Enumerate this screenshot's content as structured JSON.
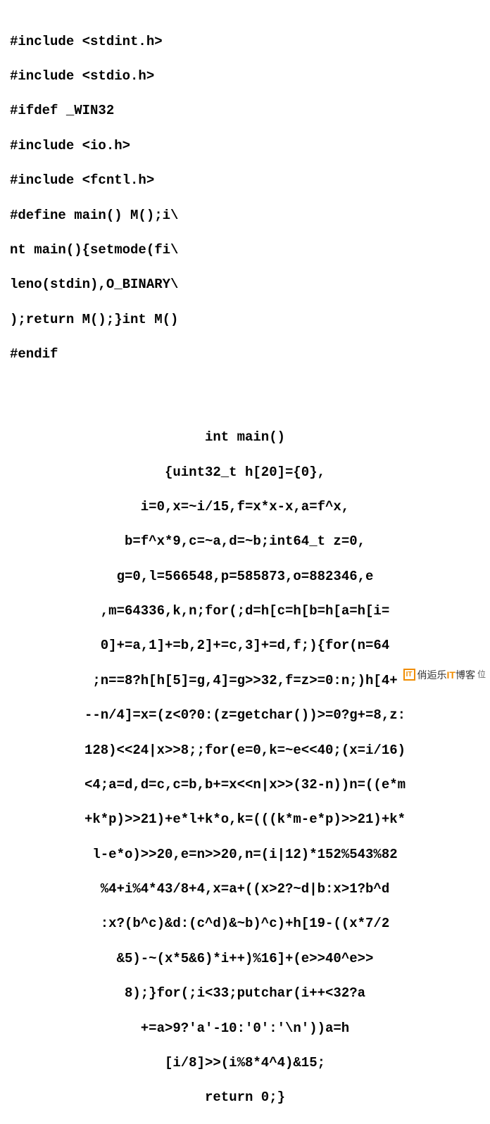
{
  "code_top": {
    "l0": "#include <stdint.h>",
    "l1": "#include <stdio.h>",
    "l2": "#ifdef _WIN32",
    "l3": "#include <io.h>",
    "l4": "#include <fcntl.h>",
    "l5": "#define main() M();i\\",
    "l6": "nt main(){setmode(fi\\",
    "l7": "leno(stdin),O_BINARY\\",
    "l8": ");return M();}int M()",
    "l9": "#endif"
  },
  "code_diamond": {
    "l0": "int main()",
    "l1": "{uint32_t h[20]={0},",
    "l2": "i=0,x=~i/15,f=x*x-x,a=f^x,",
    "l3": "b=f^x*9,c=~a,d=~b;int64_t z=0,",
    "l4": "g=0,l=566548,p=585873,o=882346,e",
    "l5": ",m=64336,k,n;for(;d=h[c=h[b=h[a=h[i=",
    "l6": "0]+=a,1]+=b,2]+=c,3]+=d,f;){for(n=64",
    "l7": ";n==8?h[h[5]=g,4]=g>>32,f=z>=0:n;)h[4+",
    "l8": "--n/4]=x=(z<0?0:(z=getchar())>=0?g+=8,z:",
    "l9": "128)<<24|x>>8;;for(e=0,k=~e<<40;(x=i/16)",
    "l10": "<4;a=d,d=c,c=b,b+=x<<n|x>>(32-n))n=((e*m",
    "l11": "+k*p)>>21)+e*l+k*o,k=(((k*m-e*p)>>21)+k*",
    "l12": "l-e*o)>>20,e=n>>20,n=(i|12)*152%543%82",
    "l13": "%4+i%4*43/8+4,x=a+((x>2?~d|b:x>1?b^d",
    "l14": ":x?(b^c)&d:(c^d)&~b)^c)+h[19-((x*7/2",
    "l15": "&5)-~(x*5&6)*i++)%16]+(e>>40^e>>",
    "l16": "8);}for(;i<33;putchar(i++<32?a",
    "l17": "+=a>9?'a'-10:'0':'\\n'))a=h",
    "l18": "[i/8]>>(i%8*4^4)&15;",
    "l19": "return 0;}"
  },
  "watermark": {
    "box": "IT",
    "text_main": "俏逅乐",
    "text_t": "IT",
    "text_blog": "博客",
    "sub": "位"
  }
}
